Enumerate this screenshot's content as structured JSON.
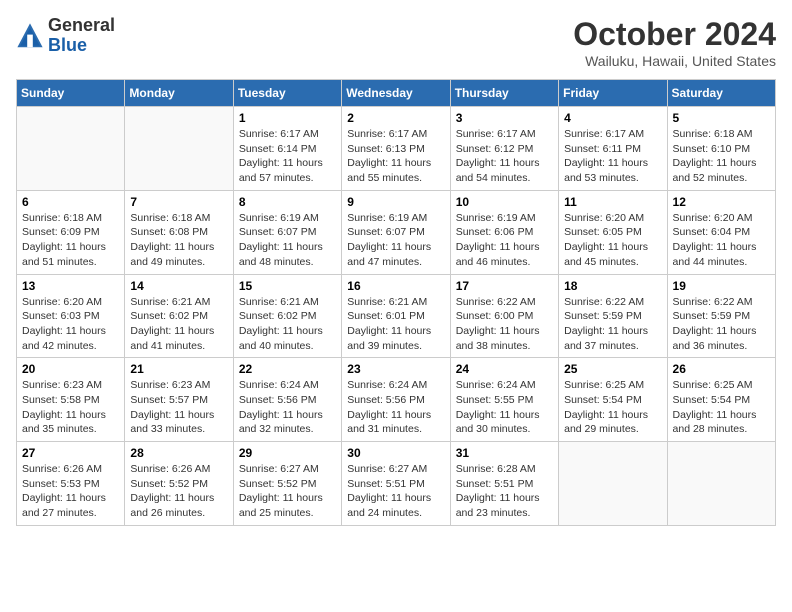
{
  "header": {
    "logo_general": "General",
    "logo_blue": "Blue",
    "month_year": "October 2024",
    "location": "Wailuku, Hawaii, United States"
  },
  "days_of_week": [
    "Sunday",
    "Monday",
    "Tuesday",
    "Wednesday",
    "Thursday",
    "Friday",
    "Saturday"
  ],
  "weeks": [
    [
      {
        "day": "",
        "sunrise": "",
        "sunset": "",
        "daylight": ""
      },
      {
        "day": "",
        "sunrise": "",
        "sunset": "",
        "daylight": ""
      },
      {
        "day": "1",
        "sunrise": "Sunrise: 6:17 AM",
        "sunset": "Sunset: 6:14 PM",
        "daylight": "Daylight: 11 hours and 57 minutes."
      },
      {
        "day": "2",
        "sunrise": "Sunrise: 6:17 AM",
        "sunset": "Sunset: 6:13 PM",
        "daylight": "Daylight: 11 hours and 55 minutes."
      },
      {
        "day": "3",
        "sunrise": "Sunrise: 6:17 AM",
        "sunset": "Sunset: 6:12 PM",
        "daylight": "Daylight: 11 hours and 54 minutes."
      },
      {
        "day": "4",
        "sunrise": "Sunrise: 6:17 AM",
        "sunset": "Sunset: 6:11 PM",
        "daylight": "Daylight: 11 hours and 53 minutes."
      },
      {
        "day": "5",
        "sunrise": "Sunrise: 6:18 AM",
        "sunset": "Sunset: 6:10 PM",
        "daylight": "Daylight: 11 hours and 52 minutes."
      }
    ],
    [
      {
        "day": "6",
        "sunrise": "Sunrise: 6:18 AM",
        "sunset": "Sunset: 6:09 PM",
        "daylight": "Daylight: 11 hours and 51 minutes."
      },
      {
        "day": "7",
        "sunrise": "Sunrise: 6:18 AM",
        "sunset": "Sunset: 6:08 PM",
        "daylight": "Daylight: 11 hours and 49 minutes."
      },
      {
        "day": "8",
        "sunrise": "Sunrise: 6:19 AM",
        "sunset": "Sunset: 6:07 PM",
        "daylight": "Daylight: 11 hours and 48 minutes."
      },
      {
        "day": "9",
        "sunrise": "Sunrise: 6:19 AM",
        "sunset": "Sunset: 6:07 PM",
        "daylight": "Daylight: 11 hours and 47 minutes."
      },
      {
        "day": "10",
        "sunrise": "Sunrise: 6:19 AM",
        "sunset": "Sunset: 6:06 PM",
        "daylight": "Daylight: 11 hours and 46 minutes."
      },
      {
        "day": "11",
        "sunrise": "Sunrise: 6:20 AM",
        "sunset": "Sunset: 6:05 PM",
        "daylight": "Daylight: 11 hours and 45 minutes."
      },
      {
        "day": "12",
        "sunrise": "Sunrise: 6:20 AM",
        "sunset": "Sunset: 6:04 PM",
        "daylight": "Daylight: 11 hours and 44 minutes."
      }
    ],
    [
      {
        "day": "13",
        "sunrise": "Sunrise: 6:20 AM",
        "sunset": "Sunset: 6:03 PM",
        "daylight": "Daylight: 11 hours and 42 minutes."
      },
      {
        "day": "14",
        "sunrise": "Sunrise: 6:21 AM",
        "sunset": "Sunset: 6:02 PM",
        "daylight": "Daylight: 11 hours and 41 minutes."
      },
      {
        "day": "15",
        "sunrise": "Sunrise: 6:21 AM",
        "sunset": "Sunset: 6:02 PM",
        "daylight": "Daylight: 11 hours and 40 minutes."
      },
      {
        "day": "16",
        "sunrise": "Sunrise: 6:21 AM",
        "sunset": "Sunset: 6:01 PM",
        "daylight": "Daylight: 11 hours and 39 minutes."
      },
      {
        "day": "17",
        "sunrise": "Sunrise: 6:22 AM",
        "sunset": "Sunset: 6:00 PM",
        "daylight": "Daylight: 11 hours and 38 minutes."
      },
      {
        "day": "18",
        "sunrise": "Sunrise: 6:22 AM",
        "sunset": "Sunset: 5:59 PM",
        "daylight": "Daylight: 11 hours and 37 minutes."
      },
      {
        "day": "19",
        "sunrise": "Sunrise: 6:22 AM",
        "sunset": "Sunset: 5:59 PM",
        "daylight": "Daylight: 11 hours and 36 minutes."
      }
    ],
    [
      {
        "day": "20",
        "sunrise": "Sunrise: 6:23 AM",
        "sunset": "Sunset: 5:58 PM",
        "daylight": "Daylight: 11 hours and 35 minutes."
      },
      {
        "day": "21",
        "sunrise": "Sunrise: 6:23 AM",
        "sunset": "Sunset: 5:57 PM",
        "daylight": "Daylight: 11 hours and 33 minutes."
      },
      {
        "day": "22",
        "sunrise": "Sunrise: 6:24 AM",
        "sunset": "Sunset: 5:56 PM",
        "daylight": "Daylight: 11 hours and 32 minutes."
      },
      {
        "day": "23",
        "sunrise": "Sunrise: 6:24 AM",
        "sunset": "Sunset: 5:56 PM",
        "daylight": "Daylight: 11 hours and 31 minutes."
      },
      {
        "day": "24",
        "sunrise": "Sunrise: 6:24 AM",
        "sunset": "Sunset: 5:55 PM",
        "daylight": "Daylight: 11 hours and 30 minutes."
      },
      {
        "day": "25",
        "sunrise": "Sunrise: 6:25 AM",
        "sunset": "Sunset: 5:54 PM",
        "daylight": "Daylight: 11 hours and 29 minutes."
      },
      {
        "day": "26",
        "sunrise": "Sunrise: 6:25 AM",
        "sunset": "Sunset: 5:54 PM",
        "daylight": "Daylight: 11 hours and 28 minutes."
      }
    ],
    [
      {
        "day": "27",
        "sunrise": "Sunrise: 6:26 AM",
        "sunset": "Sunset: 5:53 PM",
        "daylight": "Daylight: 11 hours and 27 minutes."
      },
      {
        "day": "28",
        "sunrise": "Sunrise: 6:26 AM",
        "sunset": "Sunset: 5:52 PM",
        "daylight": "Daylight: 11 hours and 26 minutes."
      },
      {
        "day": "29",
        "sunrise": "Sunrise: 6:27 AM",
        "sunset": "Sunset: 5:52 PM",
        "daylight": "Daylight: 11 hours and 25 minutes."
      },
      {
        "day": "30",
        "sunrise": "Sunrise: 6:27 AM",
        "sunset": "Sunset: 5:51 PM",
        "daylight": "Daylight: 11 hours and 24 minutes."
      },
      {
        "day": "31",
        "sunrise": "Sunrise: 6:28 AM",
        "sunset": "Sunset: 5:51 PM",
        "daylight": "Daylight: 11 hours and 23 minutes."
      },
      {
        "day": "",
        "sunrise": "",
        "sunset": "",
        "daylight": ""
      },
      {
        "day": "",
        "sunrise": "",
        "sunset": "",
        "daylight": ""
      }
    ]
  ]
}
